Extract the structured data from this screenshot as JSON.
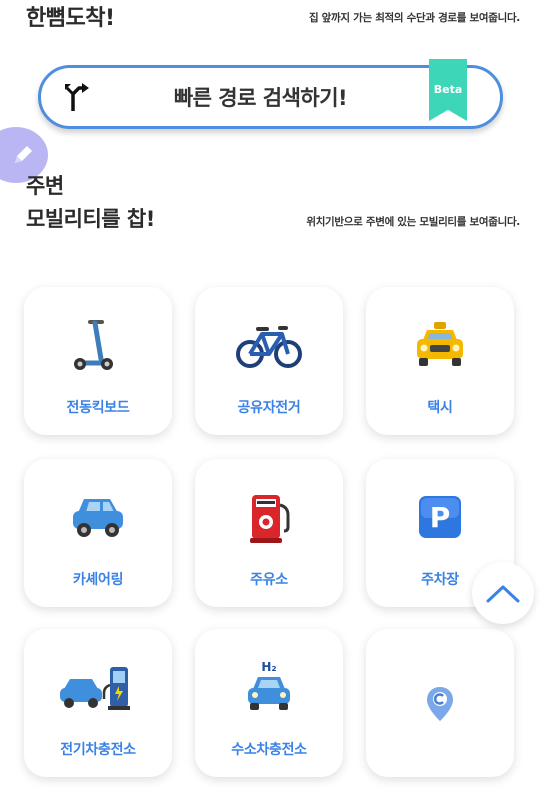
{
  "arrival": {
    "title": "한뼘도착!",
    "description": "집 앞까지 가는 최적의 수단과 경로를 보여줍니다."
  },
  "route_search": {
    "label": "빠른 경로 검색하기!",
    "badge": "Beta"
  },
  "mobility": {
    "title_line1": "주변",
    "title_line2": "모빌리티를 찹!",
    "description": "위치기반으로 주변에 있는 모빌리티를 보여줍니다."
  },
  "tiles": [
    {
      "label": "전동킥보드",
      "icon": "kick-scooter-icon"
    },
    {
      "label": "공유자전거",
      "icon": "bicycle-icon"
    },
    {
      "label": "택시",
      "icon": "taxi-icon"
    },
    {
      "label": "카셰어링",
      "icon": "car-icon"
    },
    {
      "label": "주유소",
      "icon": "fuel-pump-icon"
    },
    {
      "label": "주차장",
      "icon": "parking-icon"
    },
    {
      "label": "전기차충전소",
      "icon": "ev-charger-icon"
    },
    {
      "label": "수소차충전소",
      "icon": "hydrogen-car-icon"
    },
    {
      "label": "",
      "icon": "location-pin-icon"
    }
  ],
  "colors": {
    "accent_blue": "#3a82e6",
    "border_blue": "#4f8ddf",
    "beta_green": "#3dd6b8",
    "fab_purple": "#b9b6f3"
  }
}
